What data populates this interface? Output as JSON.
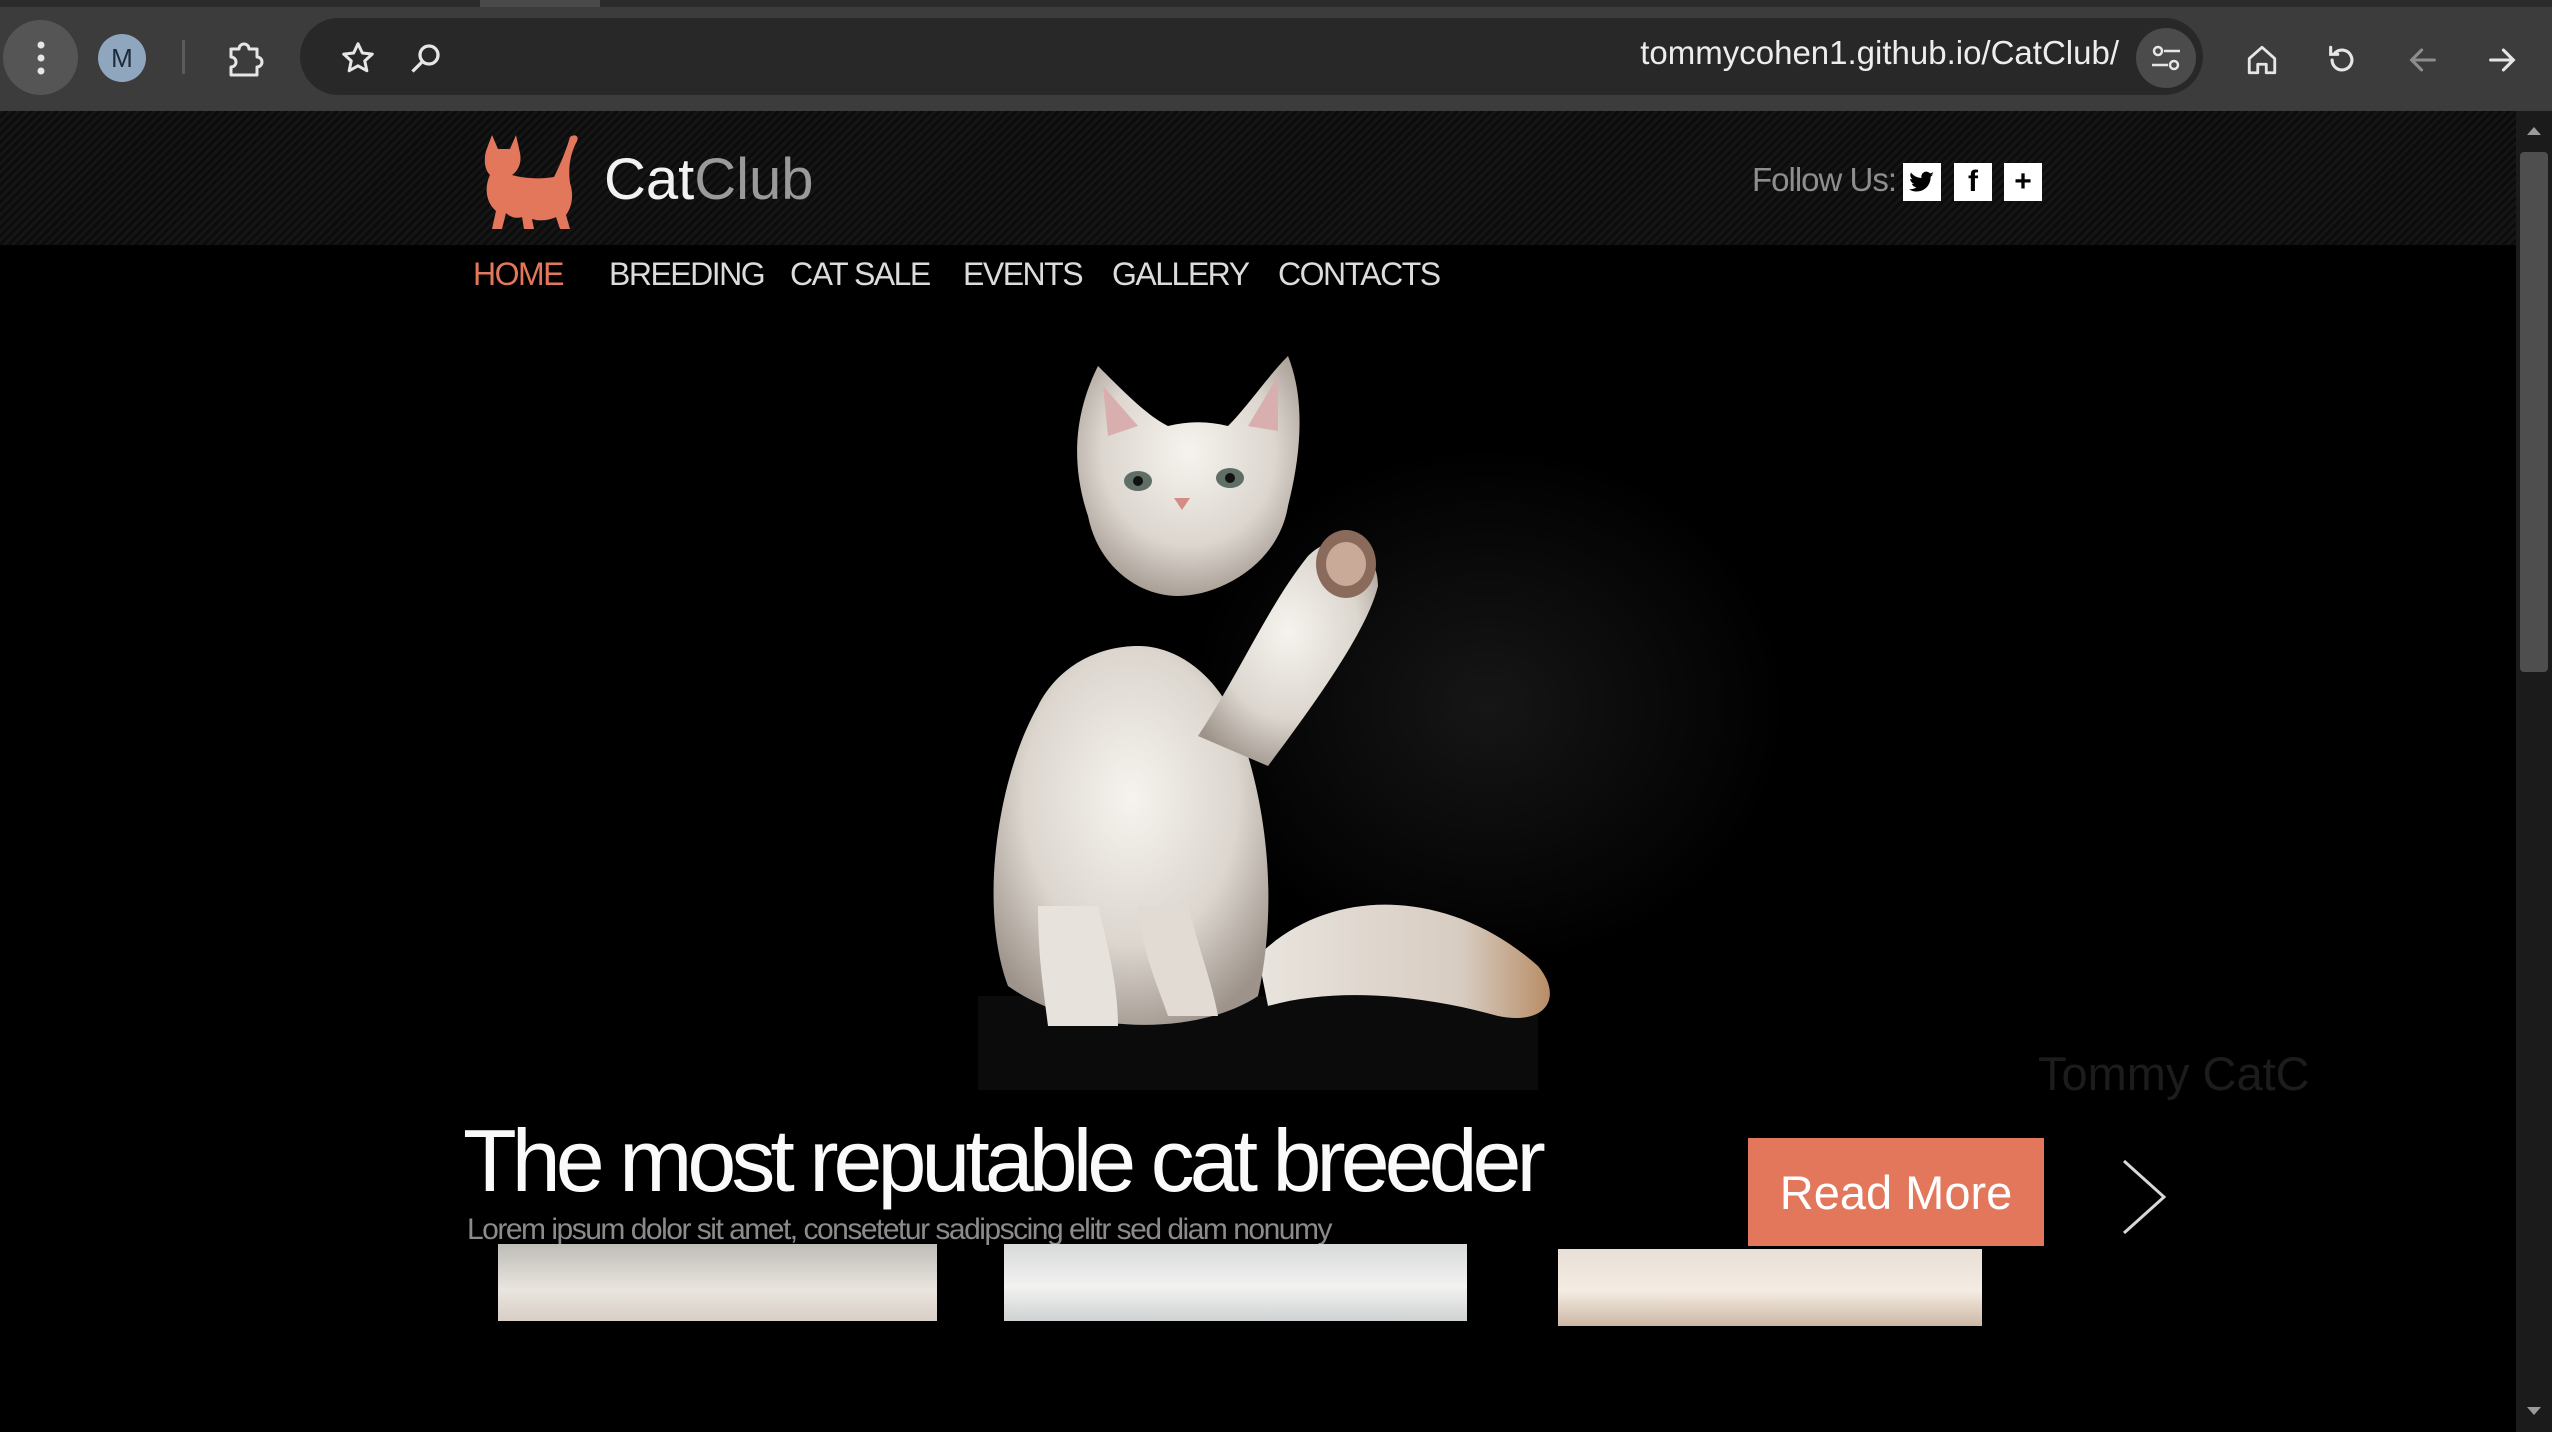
{
  "browser": {
    "profile_initial": "M",
    "url": "tommycohen1.github.io/CatClub/",
    "icons": [
      "menu-icon",
      "puzzle-icon",
      "star-icon",
      "zoom-icon",
      "tune-icon",
      "home-icon",
      "reload-icon",
      "back-arrow-icon",
      "forward-arrow-icon"
    ]
  },
  "site": {
    "brand_part1": "Cat",
    "brand_part2": "Club",
    "follow_label": "Follow Us:",
    "social": [
      {
        "name": "twitter-icon",
        "glyph": "🐦"
      },
      {
        "name": "facebook-icon",
        "glyph": "f"
      },
      {
        "name": "plus-icon",
        "glyph": "+"
      }
    ],
    "nav": [
      "HOME",
      "BREEDING",
      "CAT SALE",
      "EVENTS",
      "GALLERY",
      "CONTACTS"
    ],
    "active_nav": "HOME",
    "hero": {
      "watermark": "Tommy CatC",
      "headline": "The most reputable cat breeder",
      "subline": "Lorem ipsum dolor sit amet, consetetur sadipscing elitr sed diam nonumy",
      "button": "Read More"
    },
    "colors": {
      "accent": "#e3775c",
      "background": "#000000",
      "nav_text": "#dcdcdc",
      "brand_secondary": "#9a9a9a"
    }
  }
}
